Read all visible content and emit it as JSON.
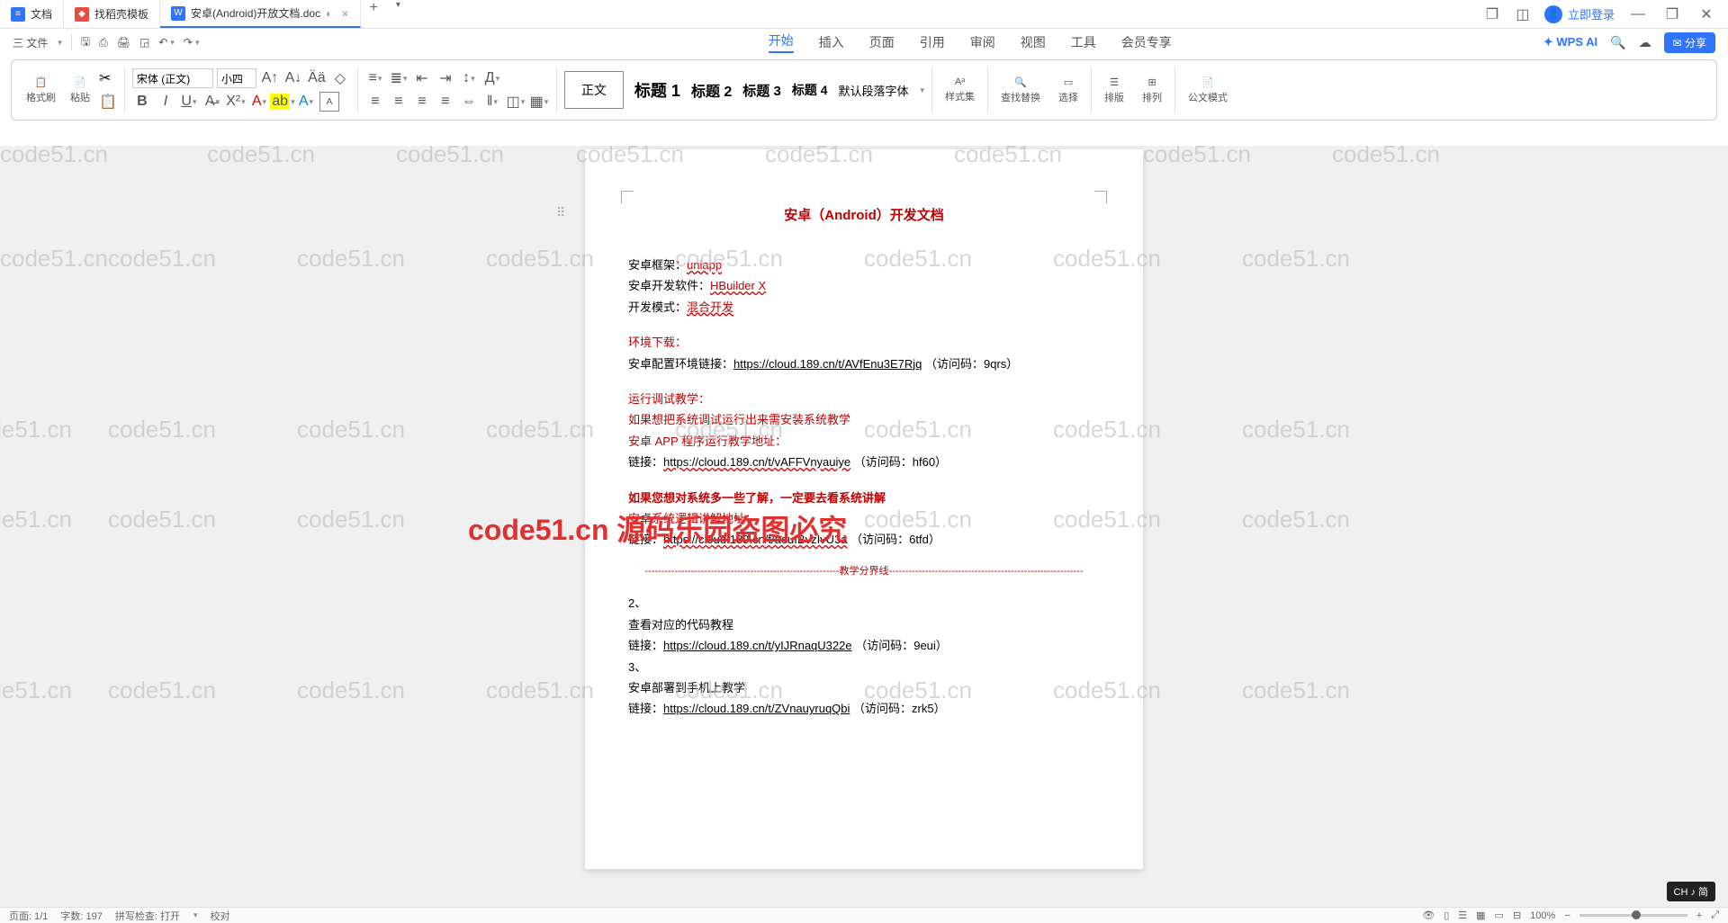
{
  "titlebar": {
    "tabs": [
      {
        "icon": "doc",
        "label": "文档"
      },
      {
        "icon": "template",
        "label": "找稻壳模板"
      },
      {
        "icon": "word",
        "label": "安卓(Android)开放文档.doc",
        "active": true
      }
    ],
    "add": "+",
    "login": "立即登录"
  },
  "filebar": {
    "menu": "三 文件"
  },
  "menu": {
    "items": [
      "开始",
      "插入",
      "页面",
      "引用",
      "审阅",
      "视图",
      "工具",
      "会员专享"
    ],
    "active": "开始",
    "wpsai": "WPS AI",
    "share": "分享"
  },
  "ribbon": {
    "format_painter": "格式刷",
    "paste": "粘贴",
    "font_name": "宋体 (正文)",
    "font_size": "小四",
    "styles": {
      "normal": "正文",
      "h1": "标题 1",
      "h2": "标题 2",
      "h3": "标题 3",
      "h4": "标题 4",
      "default_font": "默认段落字体"
    },
    "style_set": "样式集",
    "find_replace": "查找替换",
    "select": "选择",
    "arrange_v": "排版",
    "arrange_h": "排列",
    "gov_mode": "公文模式"
  },
  "document": {
    "title": "安卓（Android）开发文档",
    "framework_label": "安卓框架：",
    "framework_value": "uniapp",
    "devtool_label": "安卓开发软件：",
    "devtool_value": "HBuilder X",
    "devmode_label": "开发模式：",
    "devmode_value": "混合开发",
    "env_header": "环境下载：",
    "env_link_label": "安卓配置环境链接：",
    "env_link_url": "https://cloud.189.cn/t/AVfEnu3E7Rjq",
    "env_link_code": "（访问码：9qrs）",
    "run_header": "运行调试教学：",
    "run_note": "如果想把系统调试运行出来需安装系统教学",
    "run_app_label": "安卓 APP 程序运行教学地址：",
    "run_link_label": "链接：",
    "run_link_url": "https://cloud.189.cn/t/vAFFVnyauiye",
    "run_link_code": "（访问码：hf60）",
    "sys_header": "如果您想对系统多一些了解，一定要去看系统讲解",
    "sys_label": "安卓系统逻辑讲解地址：",
    "sys_link_label": "链接：",
    "sys_link_url": "https://cl0ud.189.cn/t/aeuIBvzIvU3a",
    "sys_link_code": "（访问码：6tfd）",
    "divider": "-----------------------------------------------------------教学分界线-----------------------------------------------------------",
    "step2": "2、",
    "step2_title": "查看对应的代码教程",
    "step2_link_label": "链接：",
    "step2_link_url": "https://cloud.189.cn/t/yIJRnaqU322e",
    "step2_link_code": "（访问码：9eui）",
    "step3": "3、",
    "step3_title": "安卓部署到手机上教学",
    "step3_link_label": "链接：",
    "step3_link_url": "https://cloud.189.cn/t/ZVnauyruqQbi",
    "step3_link_code": "（访问码：zrk5）"
  },
  "watermark": {
    "text": "code51.cn",
    "big": "code51.cn 源码乐园盗图必究"
  },
  "status": {
    "page": "页面: 1/1",
    "words": "字数: 197",
    "spell": "拼写检查: 打开",
    "proof": "校对",
    "zoom": "100%"
  },
  "ime": "CH ♪ 简"
}
